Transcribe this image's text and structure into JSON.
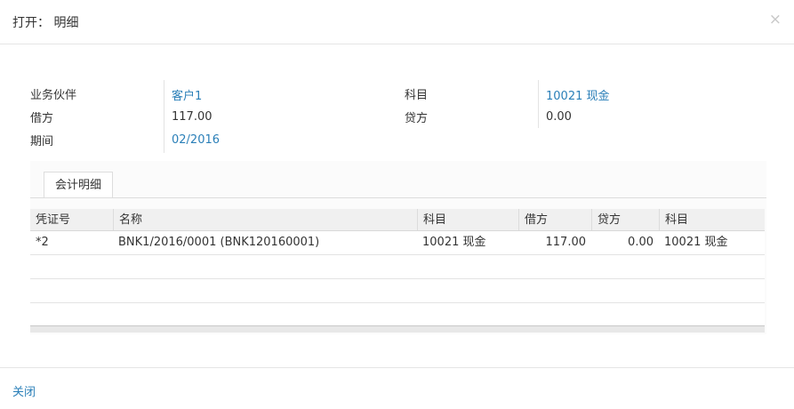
{
  "dialog": {
    "title": "打开：  明细",
    "close_symbol": "×"
  },
  "form": {
    "partner_label": "业务伙伴",
    "partner_value": "客户1",
    "debit_label": "借方",
    "debit_value": "117.00",
    "period_label": "期间",
    "period_value": "02/2016",
    "account_label": "科目",
    "account_value": "10021 现金",
    "credit_label": "贷方",
    "credit_value": "0.00"
  },
  "tabs": [
    {
      "label": "会计明细"
    }
  ],
  "grid": {
    "columns": [
      "凭证号",
      "名称",
      "科目",
      "借方",
      "贷方",
      "科目"
    ],
    "rows": [
      [
        "*2",
        "BNK1/2016/0001 (BNK120160001)",
        "10021 现金",
        "117.00",
        "0.00",
        "10021 现金"
      ]
    ]
  },
  "footer": {
    "close_label": "关闭"
  },
  "colors": {
    "link": "#2a7fb8",
    "header_bg": "#f0f0f0"
  }
}
